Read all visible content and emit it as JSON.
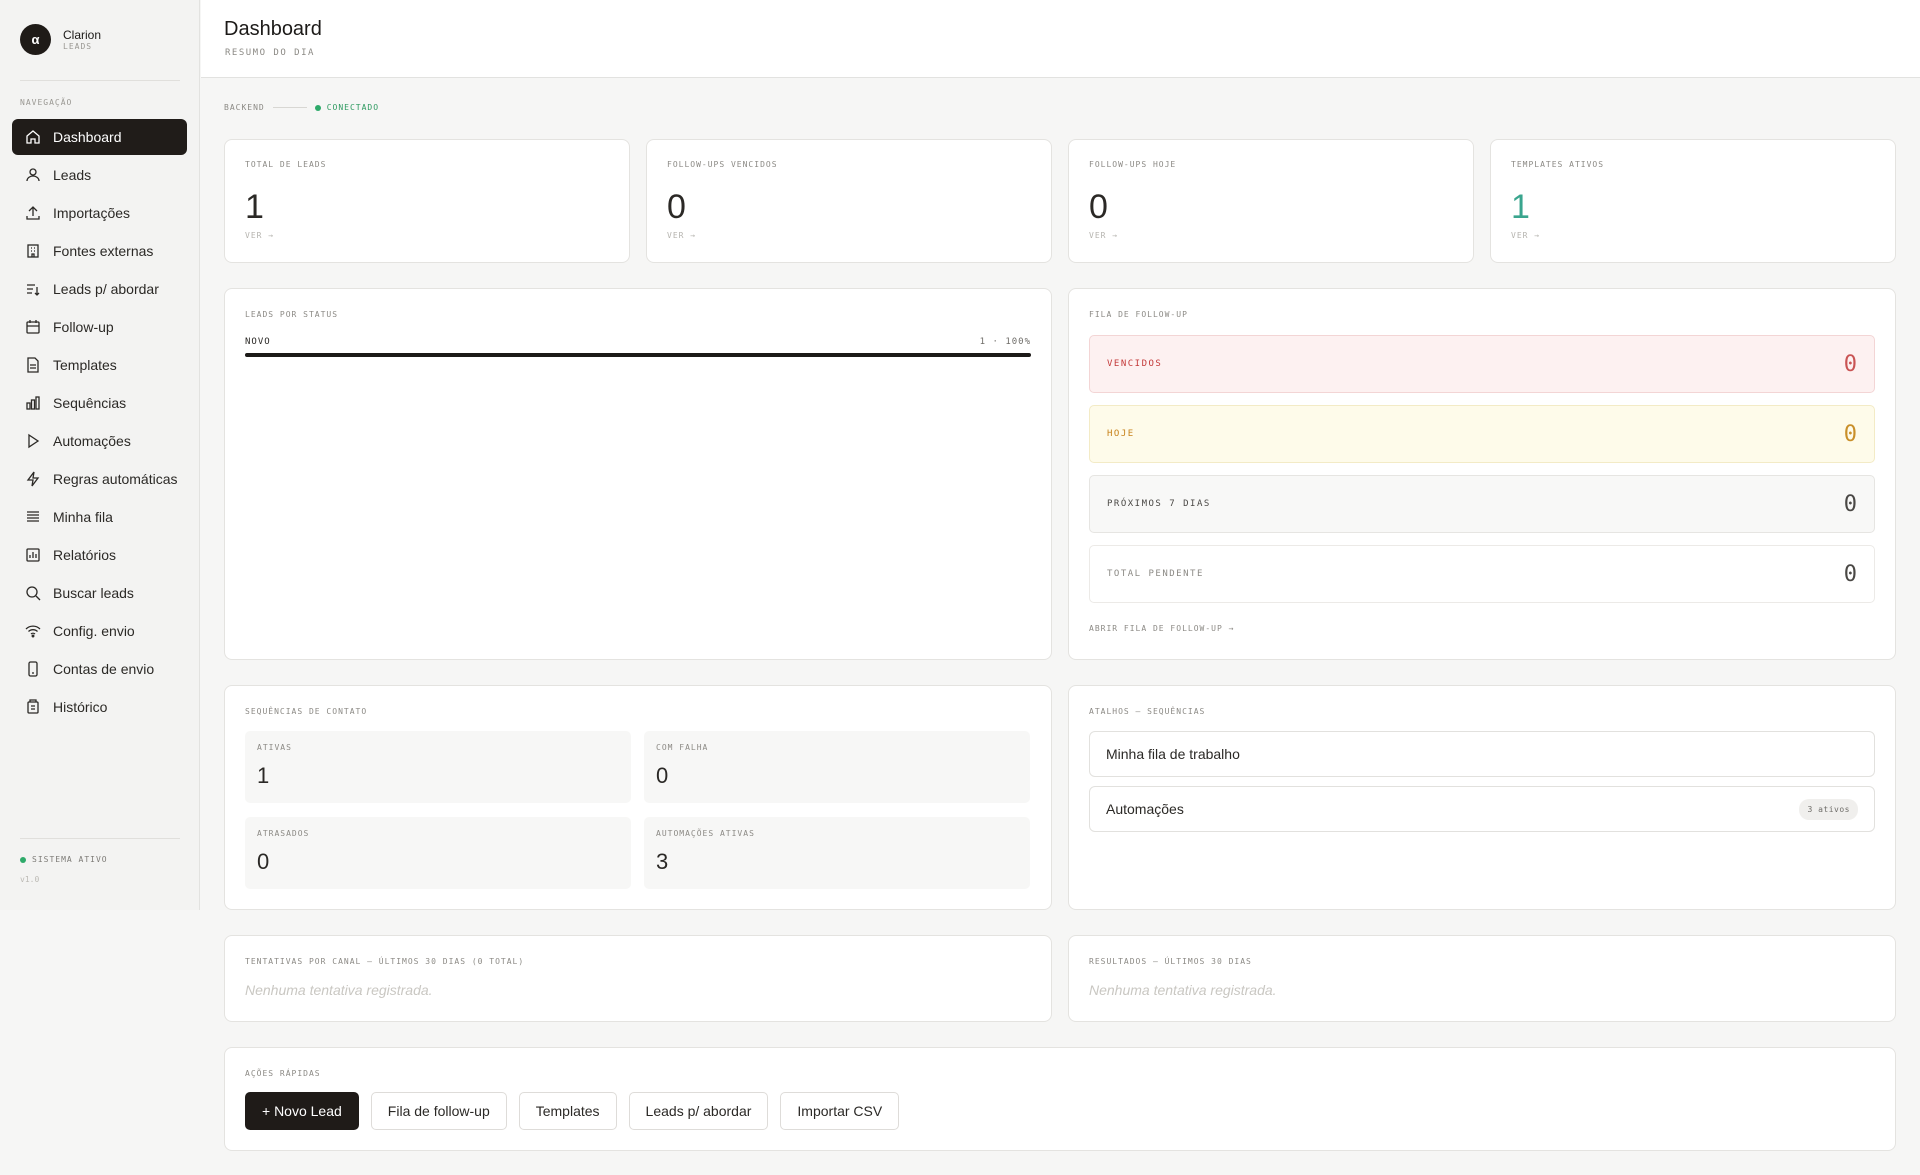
{
  "brand": {
    "name": "Clarion",
    "sub": "LEADS",
    "logo": "α"
  },
  "sidebar": {
    "heading": "NAVEGAÇÃO",
    "items": [
      {
        "label": "Dashboard",
        "icon": "home-icon",
        "active": true
      },
      {
        "label": "Leads",
        "icon": "users-icon"
      },
      {
        "label": "Importações",
        "icon": "upload-icon"
      },
      {
        "label": "Fontes externas",
        "icon": "building-icon"
      },
      {
        "label": "Leads p/ abordar",
        "icon": "list-down-icon"
      },
      {
        "label": "Follow-up",
        "icon": "calendar-icon"
      },
      {
        "label": "Templates",
        "icon": "file-icon"
      },
      {
        "label": "Sequências",
        "icon": "bar-chart-icon"
      },
      {
        "label": "Automações",
        "icon": "play-icon"
      },
      {
        "label": "Regras automáticas",
        "icon": "zap-icon"
      },
      {
        "label": "Minha fila",
        "icon": "queue-icon"
      },
      {
        "label": "Relatórios",
        "icon": "report-icon"
      },
      {
        "label": "Buscar leads",
        "icon": "search-icon"
      },
      {
        "label": "Config. envio",
        "icon": "wifi-icon"
      },
      {
        "label": "Contas de envio",
        "icon": "phone-icon"
      },
      {
        "label": "Histórico",
        "icon": "history-icon"
      }
    ],
    "status": "SISTEMA ATIVO",
    "version": "v1.0"
  },
  "header": {
    "title": "Dashboard",
    "subtitle": "RESUMO DO DIA"
  },
  "connection": {
    "label": "BACKEND",
    "status": "CONECTADO"
  },
  "stats": [
    {
      "label": "TOTAL DE LEADS",
      "value": "1",
      "link": "VER →"
    },
    {
      "label": "FOLLOW-UPS VENCIDOS",
      "value": "0",
      "link": "VER →"
    },
    {
      "label": "FOLLOW-UPS HOJE",
      "value": "0",
      "link": "VER →"
    },
    {
      "label": "TEMPLATES ATIVOS",
      "value": "1",
      "link": "VER →"
    }
  ],
  "leads_status": {
    "title": "LEADS POR STATUS",
    "rows": [
      {
        "label": "NOVO",
        "summary": "1 · 100%",
        "fraction": 1.0
      }
    ]
  },
  "followup_queue": {
    "title": "FILA DE FOLLOW-UP",
    "items": [
      {
        "label": "VENCIDOS",
        "value": "0"
      },
      {
        "label": "HOJE",
        "value": "0"
      },
      {
        "label": "PRÓXIMOS 7 DIAS",
        "value": "0"
      },
      {
        "label": "TOTAL PENDENTE",
        "value": "0"
      }
    ],
    "link": "ABRIR FILA DE FOLLOW-UP →"
  },
  "sequences": {
    "title": "SEQUÊNCIAS DE CONTATO",
    "items": [
      {
        "label": "ATIVAS",
        "value": "1"
      },
      {
        "label": "COM FALHA",
        "value": "0"
      },
      {
        "label": "ATRASADOS",
        "value": "0"
      },
      {
        "label": "AUTOMAÇÕES ATIVAS",
        "value": "3"
      }
    ]
  },
  "shortcuts": {
    "title": "ATALHOS — SEQUÊNCIAS",
    "items": [
      {
        "label": "Minha fila de trabalho",
        "badge": ""
      },
      {
        "label": "Automações",
        "badge": "3 ativos"
      }
    ]
  },
  "attempts": {
    "title": "TENTATIVAS POR CANAL — ÚLTIMOS 30 DIAS (0 TOTAL)",
    "empty": "Nenhuma tentativa registrada."
  },
  "results": {
    "title": "RESULTADOS — ÚLTIMOS 30 DIAS",
    "empty": "Nenhuma tentativa registrada."
  },
  "quick_actions": {
    "title": "AÇÕES RÁPIDAS",
    "buttons": [
      "+ Novo Lead",
      "Fila de follow-up",
      "Templates",
      "Leads p/ abordar",
      "Importar CSV"
    ]
  }
}
